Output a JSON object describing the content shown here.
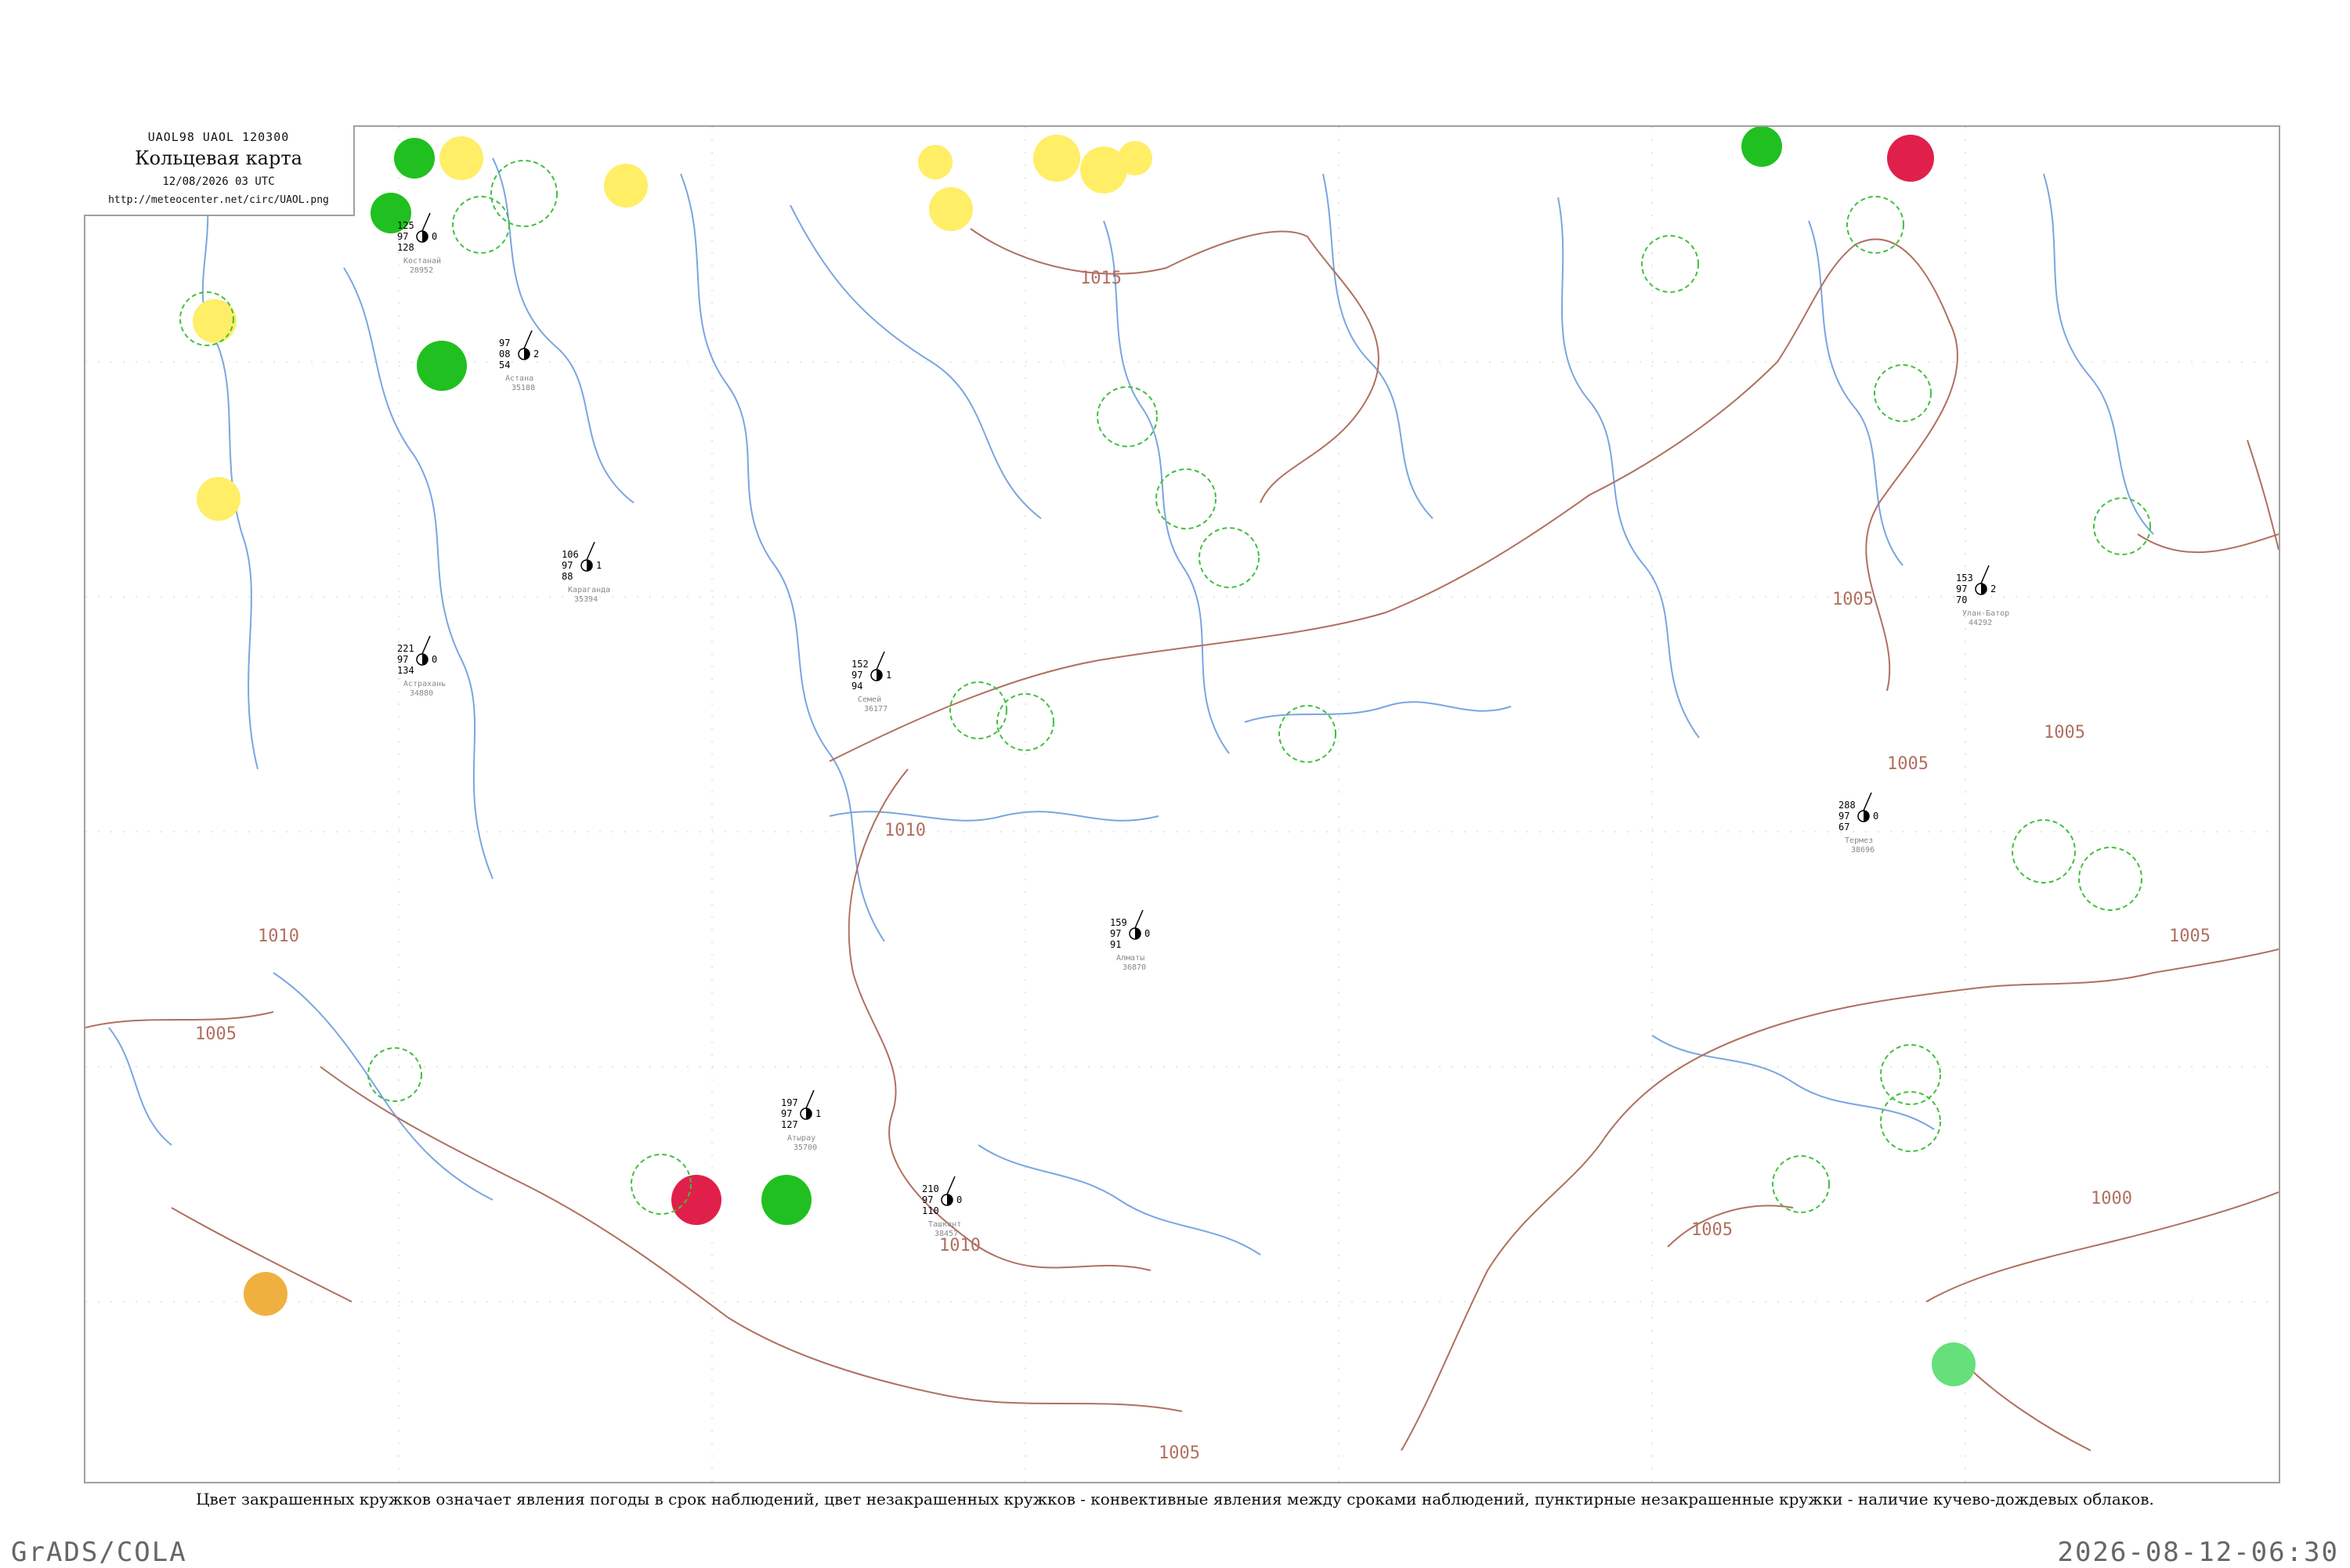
{
  "header": {
    "code_line": "UAOL98  UAOL  120300",
    "title": "Кольцевая карта",
    "datetime": "12/08/2026 03 UTC",
    "url": "http://meteocenter.net/circ/UAOL.png"
  },
  "caption": "Цвет закрашенных кружков означает явления погоды в срок наблюдений, цвет незакрашенных кружков - конвективные явления между сроками наблюдений, пунктирные незакрашенные кружки - наличие кучево-дождевых облаков.",
  "footer": {
    "software": "GrADS/COLA",
    "timestamp": "2026-08-12-06:30"
  },
  "colors": {
    "isobar": "#b07060",
    "river": "#7aa6e0",
    "rain": "#20c020",
    "thunder": "#e0204a",
    "fog": "#ffee66",
    "dust": "#f0b040",
    "shower": "#66e07a",
    "cb_ring": "#40c040"
  },
  "isobar_labels": [
    "1015",
    "1010",
    "1010",
    "1005",
    "1010",
    "1005",
    "1005",
    "1005",
    "1005",
    "1000",
    "1005",
    "1005"
  ],
  "stations": [
    {
      "id": "28952",
      "name": "Костанай",
      "t": "125",
      "p": "97",
      "d": "128",
      "w": "0"
    },
    {
      "id": "35188",
      "name": "Астана",
      "t": "97",
      "p": "08",
      "d": "54",
      "w": "2"
    },
    {
      "id": "35394",
      "name": "Караганда",
      "t": "106",
      "p": "97",
      "d": "88",
      "w": "1"
    },
    {
      "id": "36177",
      "name": "Семей",
      "t": "152",
      "p": "97",
      "d": "94",
      "w": "1"
    },
    {
      "id": "36870",
      "name": "Алматы",
      "t": "159",
      "p": "97",
      "d": "91",
      "w": "0"
    },
    {
      "id": "38457",
      "name": "Ташкент",
      "t": "210",
      "p": "97",
      "d": "110",
      "w": "0"
    },
    {
      "id": "35700",
      "name": "Атырау",
      "t": "197",
      "p": "97",
      "d": "127",
      "w": "1"
    },
    {
      "id": "34880",
      "name": "Астрахань",
      "t": "221",
      "p": "97",
      "d": "134",
      "w": "0"
    },
    {
      "id": "38696",
      "name": "Термез",
      "t": "288",
      "p": "97",
      "d": "67",
      "w": "0"
    },
    {
      "id": "44292",
      "name": "Улан-Батор",
      "t": "153",
      "p": "97",
      "d": "70",
      "w": "2"
    }
  ],
  "wx_circles": [
    {
      "type": "rain",
      "label": "rain"
    },
    {
      "type": "thunder",
      "label": "thunder"
    },
    {
      "type": "fog",
      "label": "fog"
    }
  ]
}
